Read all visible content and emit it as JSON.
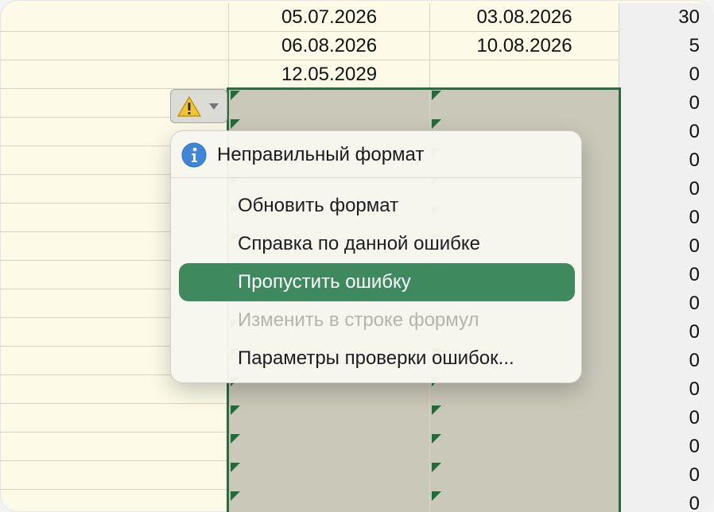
{
  "rows": [
    {
      "d1": "05.07.2026",
      "d2": "03.08.2026",
      "n": "30"
    },
    {
      "d1": "06.08.2026",
      "d2": "10.08.2026",
      "n": "5"
    },
    {
      "d1": "12.05.2029",
      "d2": "",
      "n": "0"
    },
    {
      "d1": "",
      "d2": "",
      "n": "0"
    },
    {
      "d1": "",
      "d2": "",
      "n": "0"
    },
    {
      "d1": "",
      "d2": "",
      "n": "0"
    },
    {
      "d1": "",
      "d2": "",
      "n": "0"
    },
    {
      "d1": "",
      "d2": "",
      "n": "0"
    },
    {
      "d1": "",
      "d2": "",
      "n": "0"
    },
    {
      "d1": "",
      "d2": "",
      "n": "0"
    },
    {
      "d1": "",
      "d2": "",
      "n": "0"
    },
    {
      "d1": "",
      "d2": "",
      "n": "0"
    },
    {
      "d1": "",
      "d2": "",
      "n": "0"
    },
    {
      "d1": "",
      "d2": "",
      "n": "0"
    },
    {
      "d1": "",
      "d2": "",
      "n": "0"
    },
    {
      "d1": "",
      "d2": "",
      "n": "0"
    },
    {
      "d1": "",
      "d2": "",
      "n": "0"
    },
    {
      "d1": "",
      "d2": "",
      "n": "0"
    }
  ],
  "selection_start_row": 3,
  "error_menu": {
    "title": "Неправильный формат",
    "info_icon": "info-icon",
    "warning_icon": "warning-icon",
    "items": [
      {
        "label": "Обновить формат",
        "state": "normal"
      },
      {
        "label": "Справка по данной ошибке",
        "state": "normal"
      },
      {
        "label": "Пропустить ошибку",
        "state": "active"
      },
      {
        "label": "Изменить в строке формул",
        "state": "disabled"
      },
      {
        "label": "Параметры проверки ошибок...",
        "state": "normal"
      }
    ]
  },
  "colors": {
    "selection_border": "#2c6a42",
    "active_item": "#3e8a5e",
    "cell_bg": "#fdfbe8",
    "selected_bg": "#c9c8b9"
  }
}
